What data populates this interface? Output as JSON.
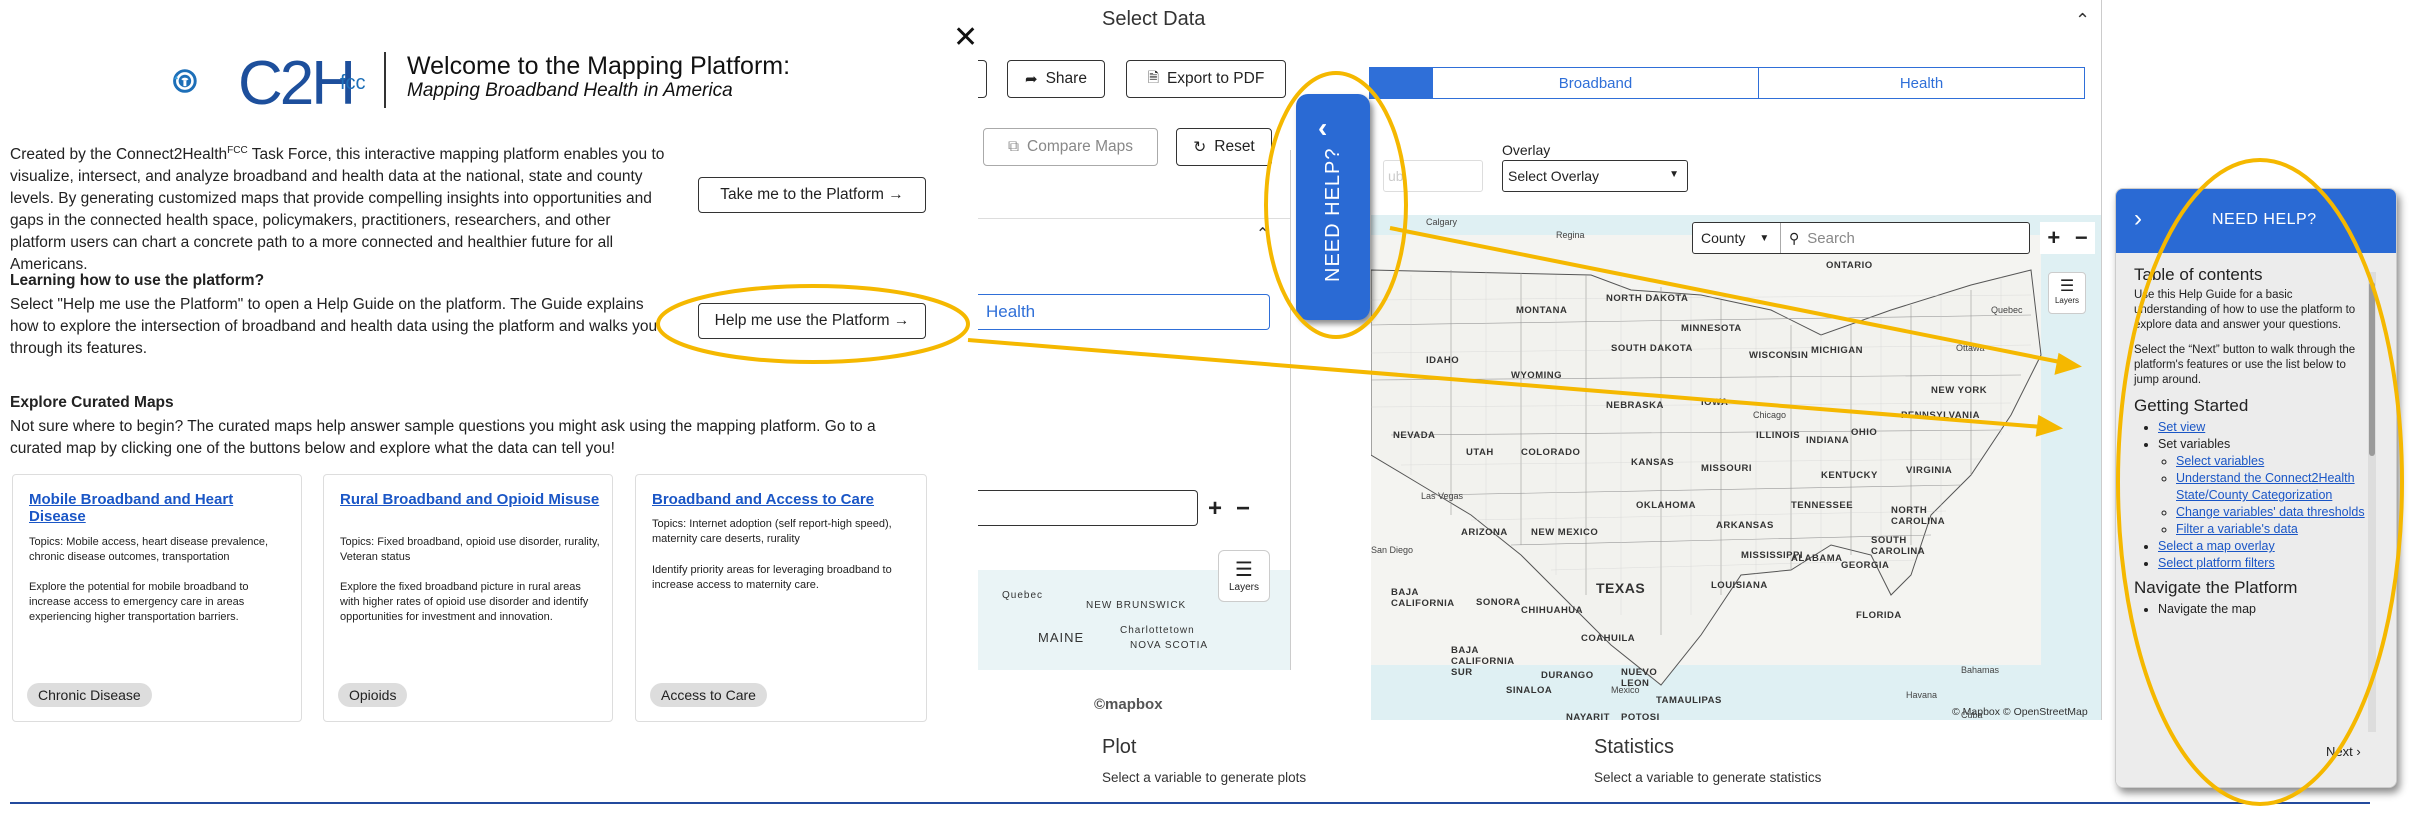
{
  "welcome": {
    "logo_text": "C2H",
    "logo_sub": "fcc",
    "title": "Welcome to the Mapping Platform:",
    "subtitle": "Mapping Broadband Health in America",
    "intro_pre": "Created by the Connect2Health",
    "intro_sup": "FCC",
    "intro_post": " Task Force, this interactive mapping platform enables you to visualize, intersect, and analyze broadband and health data at the national, state and county levels. By generating customized maps that provide compelling insights into opportunities and gaps in the connected health space, policymakers, practitioners, researchers, and other platform users can chart a concrete path to a more connected and healthier future for all Americans.",
    "learn_heading": "Learning how to use the platform?",
    "learn_text": "Select \"Help me use the Platform\" to open a Help Guide on the platform. The Guide explains how to explore the intersection of broadband and health data using the platform and walks you through its features.",
    "explore_heading": "Explore Curated Maps",
    "explore_text": "Not sure where to begin? The curated maps help answer sample questions you might ask using the mapping platform. Go to a curated map by clicking one of the buttons below and explore what the data can tell you!",
    "btn_take": "Take me to the Platform →",
    "btn_help": "Help me use the Platform →"
  },
  "cards": [
    {
      "title": "Mobile Broadband and Heart Disease",
      "topics": "Topics: Mobile access, heart disease prevalence, chronic disease outcomes, transportation",
      "desc": "Explore the potential for mobile broadband to increase access to emergency care in areas experiencing higher transportation barriers.",
      "tag": "Chronic Disease"
    },
    {
      "title": "Rural Broadband and Opioid Misuse",
      "topics": "Topics: Fixed broadband, opioid use disorder, rurality, Veteran status",
      "desc": "Explore the fixed broadband picture in rural areas with higher rates of opioid use disorder and identify opportunities for investment and innovation.",
      "tag": "Opioids"
    },
    {
      "title": "Broadband and Access to Care",
      "topics": "Topics: Internet adoption (self report-high speed), maternity care deserts, rurality",
      "desc": "Identify priority areas for leveraging broadband to increase access to maternity care.",
      "tag": "Access to Care"
    }
  ],
  "platform": {
    "close": "✕",
    "select_data": "Select Data",
    "share": "Share",
    "export": "Export to PDF",
    "compare": "Compare Maps",
    "reset": "Reset",
    "tabs": [
      "",
      "Broadband",
      "Health"
    ],
    "overlay_label": "Overlay",
    "overlay_value": "Select Overlay",
    "health_field": "Health",
    "county_select": "County",
    "search_placeholder": "Search",
    "layers": "Layers",
    "mapbox": "©mapbox",
    "attribution": "© Mapbox © OpenStreetMap",
    "plot_heading": "Plot",
    "plot_text": "Select a variable to generate plots",
    "stats_heading": "Statistics",
    "stats_text": "Select a variable to generate statistics",
    "faded_select": "ub"
  },
  "map_labels": {
    "states": [
      "NORTH DAKOTA",
      "MONTANA",
      "SOUTH DAKOTA",
      "MINNESOTA",
      "WISCONSIN",
      "MICHIGAN",
      "IDAHO",
      "WYOMING",
      "NEBRASKA",
      "IOWA",
      "NEVADA",
      "UTAH",
      "COLORADO",
      "KANSAS",
      "MISSOURI",
      "ILLINOIS",
      "INDIANA",
      "OHIO",
      "PENNSYLVANIA",
      "NEW YORK",
      "ARIZONA",
      "NEW MEXICO",
      "OKLAHOMA",
      "ARKANSAS",
      "TENNESSEE",
      "KENTUCKY",
      "VIRGINIA",
      "NORTH CAROLINA",
      "SOUTH CAROLINA",
      "GEORGIA",
      "ALABAMA",
      "MISSISSIPPI",
      "LOUISIANA",
      "TEXAS",
      "FLORIDA",
      "ONTARIO",
      "SONORA",
      "CHIHUAHUA",
      "COAHUILA",
      "BAJA CALIFORNIA",
      "DURANGO",
      "NUEVO LEON",
      "TAMAULIPAS",
      "BAJA CALIFORNIA SUR",
      "SINALOA",
      "NAYARIT",
      "POTOSI"
    ],
    "cities": [
      "Calgary",
      "Regina",
      "Chicago",
      "Ottawa",
      "Quebec",
      "Las Vegas",
      "San Diego",
      "Mexico",
      "Havana",
      "Cuba",
      "Bahamas"
    ],
    "left_map": [
      "Quebec",
      "NEW BRUNSWICK",
      "MAINE",
      "Charlottetown",
      "NOVA SCOTIA"
    ]
  },
  "need_help_tab": {
    "chevron": "‹",
    "label": "NEED HELP?"
  },
  "help_panel": {
    "header": "NEED HELP?",
    "toc_heading": "Table of contents",
    "toc_p1": "Use this Help Guide for a basic understanding of how to use the platform to explore data and answer your questions.",
    "toc_p2": "Select the “Next” button to walk through the platform's features or use the list below to jump around.",
    "getting_started": "Getting Started",
    "set_view": "Set view",
    "set_variables": "Set variables",
    "sub_items": [
      "Select variables",
      "Understand the Connect2Health State/County Categorization",
      "Change variables' data thresholds",
      "Filter a variable's data"
    ],
    "select_overlay": "Select a map overlay",
    "select_filters": "Select platform filters",
    "navigate": "Navigate the Platform",
    "navigate_map": "Navigate the map",
    "next": "Next ›"
  },
  "colors": {
    "accent_blue": "#2a6ad4",
    "annotation_yellow": "#f5b800",
    "divider_blue": "#234a9d"
  }
}
